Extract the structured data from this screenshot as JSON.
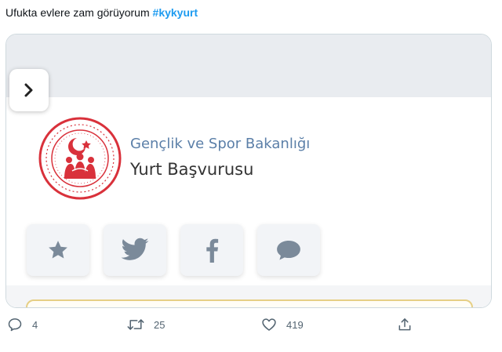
{
  "tweet": {
    "text": "Ufukta evlere zam görüyorum",
    "hashtag": "#kykyurt"
  },
  "card": {
    "ministry_name": "Gençlik ve Spor Bakanlığı",
    "service_name": "Yurt Başvurusu",
    "share_buttons": [
      {
        "icon": "star-icon"
      },
      {
        "icon": "twitter-icon"
      },
      {
        "icon": "facebook-icon"
      },
      {
        "icon": "comment-icon"
      }
    ],
    "colors": {
      "ministry_text": "#5b7fa8",
      "logo_red": "#d9313b",
      "share_icon": "#7b8a9a"
    }
  },
  "actions": {
    "reply_count": "4",
    "retweet_count": "25",
    "like_count": "419"
  }
}
